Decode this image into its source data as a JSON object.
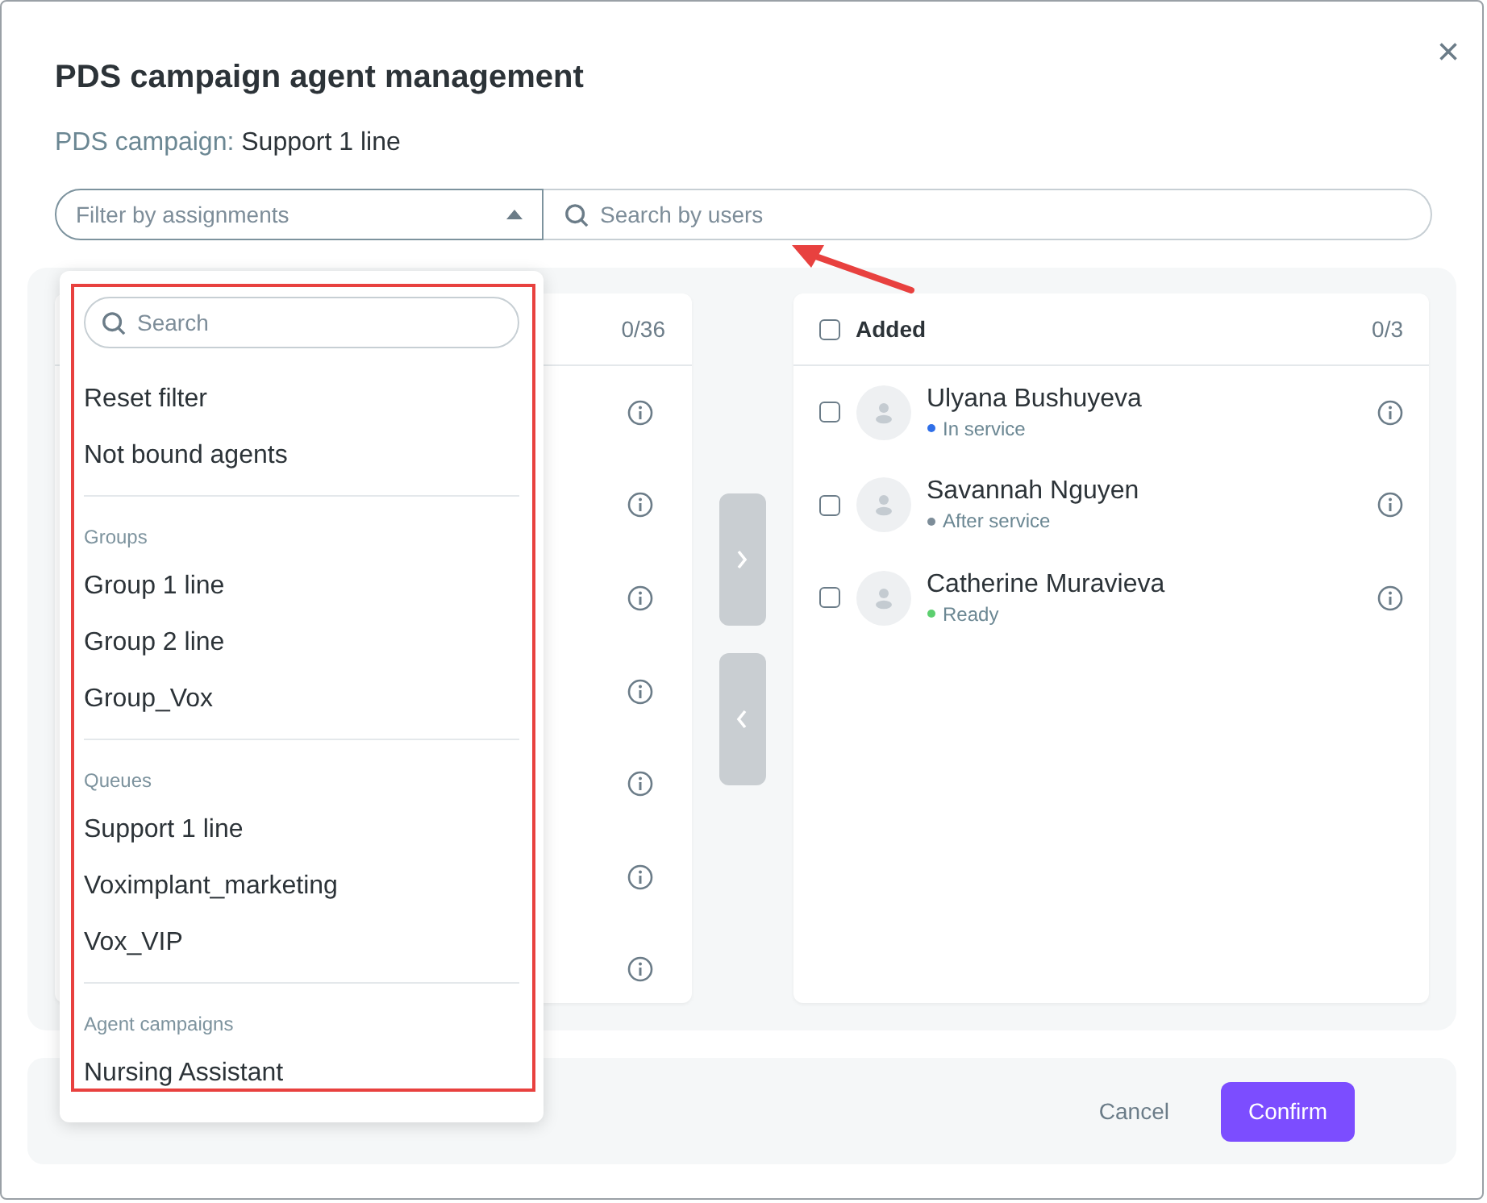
{
  "dialog": {
    "title": "PDS campaign agent management",
    "close_icon": "×",
    "campaign_label": "PDS campaign:",
    "campaign_value": "Support 1 line"
  },
  "filter": {
    "placeholder": "Filter by assignments",
    "expanded": true
  },
  "user_search": {
    "placeholder": "Search by users"
  },
  "available": {
    "count": "0/36"
  },
  "added": {
    "title": "Added",
    "count": "0/3",
    "checked": false,
    "agents": [
      {
        "name": "Ulyana Bushuyeva",
        "status": "In service",
        "color": "#2f6fe8",
        "checked": false
      },
      {
        "name": "Savannah Nguyen",
        "status": "After service",
        "color": "#7d8d99",
        "checked": false
      },
      {
        "name": "Catherine Muravieva",
        "status": "Ready",
        "color": "#5ccf6f",
        "checked": false
      }
    ]
  },
  "dropdown": {
    "search_placeholder": "Search",
    "items": [
      {
        "kind": "option",
        "label": "Reset filter"
      },
      {
        "kind": "option",
        "label": "Not bound agents"
      },
      {
        "kind": "divider"
      },
      {
        "kind": "header",
        "label": "Groups"
      },
      {
        "kind": "option",
        "label": "Group 1 line"
      },
      {
        "kind": "option",
        "label": "Group 2 line"
      },
      {
        "kind": "option",
        "label": "Group_Vox"
      },
      {
        "kind": "divider"
      },
      {
        "kind": "header",
        "label": "Queues"
      },
      {
        "kind": "option",
        "label": "Support 1 line"
      },
      {
        "kind": "option",
        "label": "Voximplant_marketing"
      },
      {
        "kind": "option",
        "label": "Vox_VIP"
      },
      {
        "kind": "divider"
      },
      {
        "kind": "header",
        "label": "Agent campaigns"
      },
      {
        "kind": "option",
        "label": "Nursing Assistant"
      }
    ]
  },
  "buttons": {
    "cancel": "Cancel",
    "confirm": "Confirm"
  }
}
